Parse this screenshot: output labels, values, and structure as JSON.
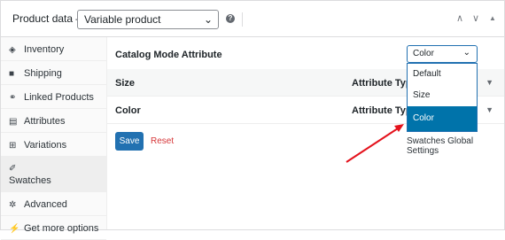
{
  "header": {
    "title": "Product data —",
    "product_type": "Variable product",
    "help": "?",
    "up": "∧",
    "down": "∨",
    "collapse": "▲"
  },
  "sidebar": {
    "items": [
      {
        "label": "Inventory",
        "icon": "◈"
      },
      {
        "label": "Shipping",
        "icon": "■"
      },
      {
        "label": "Linked Products",
        "icon": "⚭"
      },
      {
        "label": "Attributes",
        "icon": "▤"
      },
      {
        "label": "Variations",
        "icon": "⊞"
      },
      {
        "label": "Swatches",
        "icon": "✐"
      },
      {
        "label": "Advanced",
        "icon": "✲"
      },
      {
        "label": "Get more options",
        "icon": "⚡"
      }
    ]
  },
  "main": {
    "catalog_label": "Catalog Mode Attribute",
    "catalog_value": "Color",
    "dropdown_options": [
      "Default",
      "Size",
      "Color"
    ],
    "rows": [
      {
        "name": "Size",
        "attr_type_label": "Attribute Type"
      },
      {
        "name": "Color",
        "attr_type_label": "Attribute Type"
      }
    ],
    "save_label": "Save",
    "reset_label": "Reset",
    "global_settings_label": "Swatches Global Settings"
  },
  "colors": {
    "accent": "#2271b1",
    "selected": "#0073aa",
    "reset": "#d63638",
    "arrow": "#e4121c"
  }
}
